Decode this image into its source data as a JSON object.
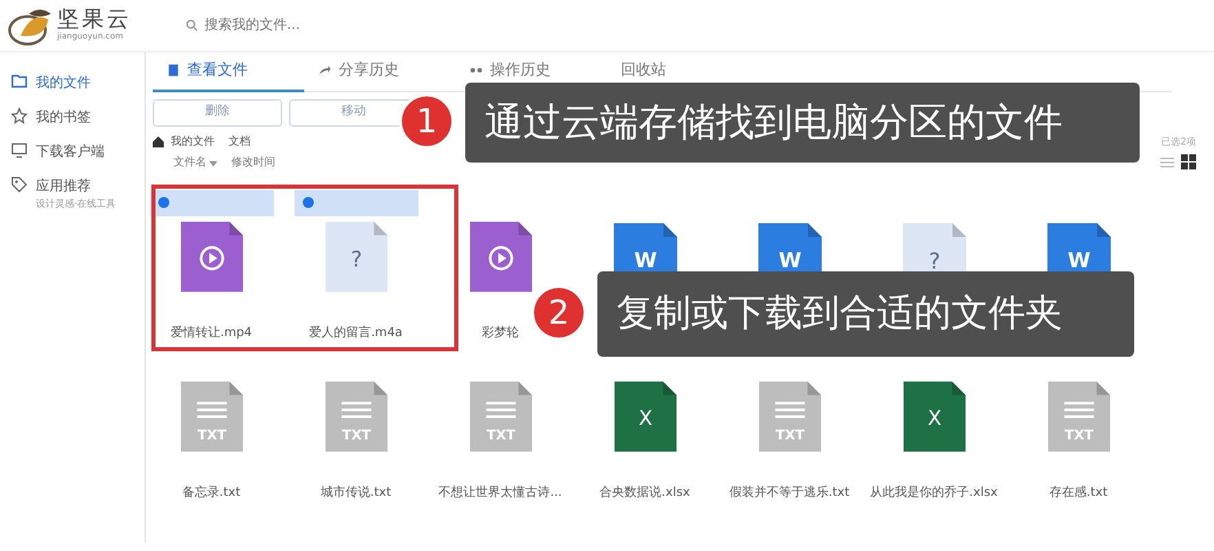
{
  "app": {
    "logo_text": "坚果云",
    "logo_subtext": "jianguoyun.com"
  },
  "search": {
    "placeholder": "搜索我的文件..."
  },
  "sidebar": {
    "items": [
      {
        "label": "我的文件",
        "selected": true
      },
      {
        "label": "我的书签",
        "selected": false
      },
      {
        "label": "下载客户端",
        "selected": false
      },
      {
        "label": "应用推荐",
        "sublabel": "设计灵感·在线工具",
        "selected": false
      }
    ]
  },
  "tabs": [
    {
      "label": "查看文件",
      "selected": true
    },
    {
      "label": "分享历史",
      "selected": false
    },
    {
      "label": "操作历史",
      "selected": false
    },
    {
      "label": "回收站",
      "selected": false
    }
  ],
  "toolbar": {
    "buttons": [
      "删除",
      "移动"
    ]
  },
  "breadcrumb": [
    "我的文件",
    "文档"
  ],
  "columns": [
    {
      "label": "文件名",
      "sorted": true
    },
    {
      "label": "修改时间",
      "sorted": false
    }
  ],
  "selection_count": "已选2项",
  "files": [
    {
      "name": "爱情转让.mp4",
      "kind": "video",
      "selected": true
    },
    {
      "name": "爱人的留言.m4a",
      "kind": "unknown",
      "icon_text": "?",
      "selected": true
    },
    {
      "name": "彩梦轮",
      "kind": "video",
      "selected": false
    },
    {
      "kind": "word",
      "icon_text": "W",
      "selected": false
    },
    {
      "kind": "word",
      "icon_text": "W",
      "selected": false
    },
    {
      "kind": "unknown",
      "icon_text": "?",
      "selected": false
    },
    {
      "kind": "word",
      "icon_text": "W",
      "selected": false
    },
    {
      "name": "备忘录.txt",
      "kind": "txt",
      "icon_text": "TXT",
      "selected": false
    },
    {
      "name": "城市传说.txt",
      "kind": "txt",
      "icon_text": "TXT",
      "selected": false
    },
    {
      "name": "不想让世界太懂古诗...",
      "kind": "txt",
      "icon_text": "TXT",
      "selected": false
    },
    {
      "name": "合央数据说.xlsx",
      "kind": "excel",
      "icon_text": "X",
      "selected": false
    },
    {
      "name": "假装并不等于逃乐.txt",
      "kind": "txt",
      "icon_text": "TXT",
      "selected": false
    },
    {
      "name": "从此我是你的乔子.xlsx",
      "kind": "excel",
      "icon_text": "X",
      "selected": false
    },
    {
      "name": "存在感.txt",
      "kind": "txt",
      "icon_text": "TXT",
      "selected": false
    }
  ],
  "callouts": [
    {
      "number": "1",
      "text": "通过云端存储找到电脑分区的文件"
    },
    {
      "number": "2",
      "text": "复制或下载到合适的文件夹"
    }
  ]
}
